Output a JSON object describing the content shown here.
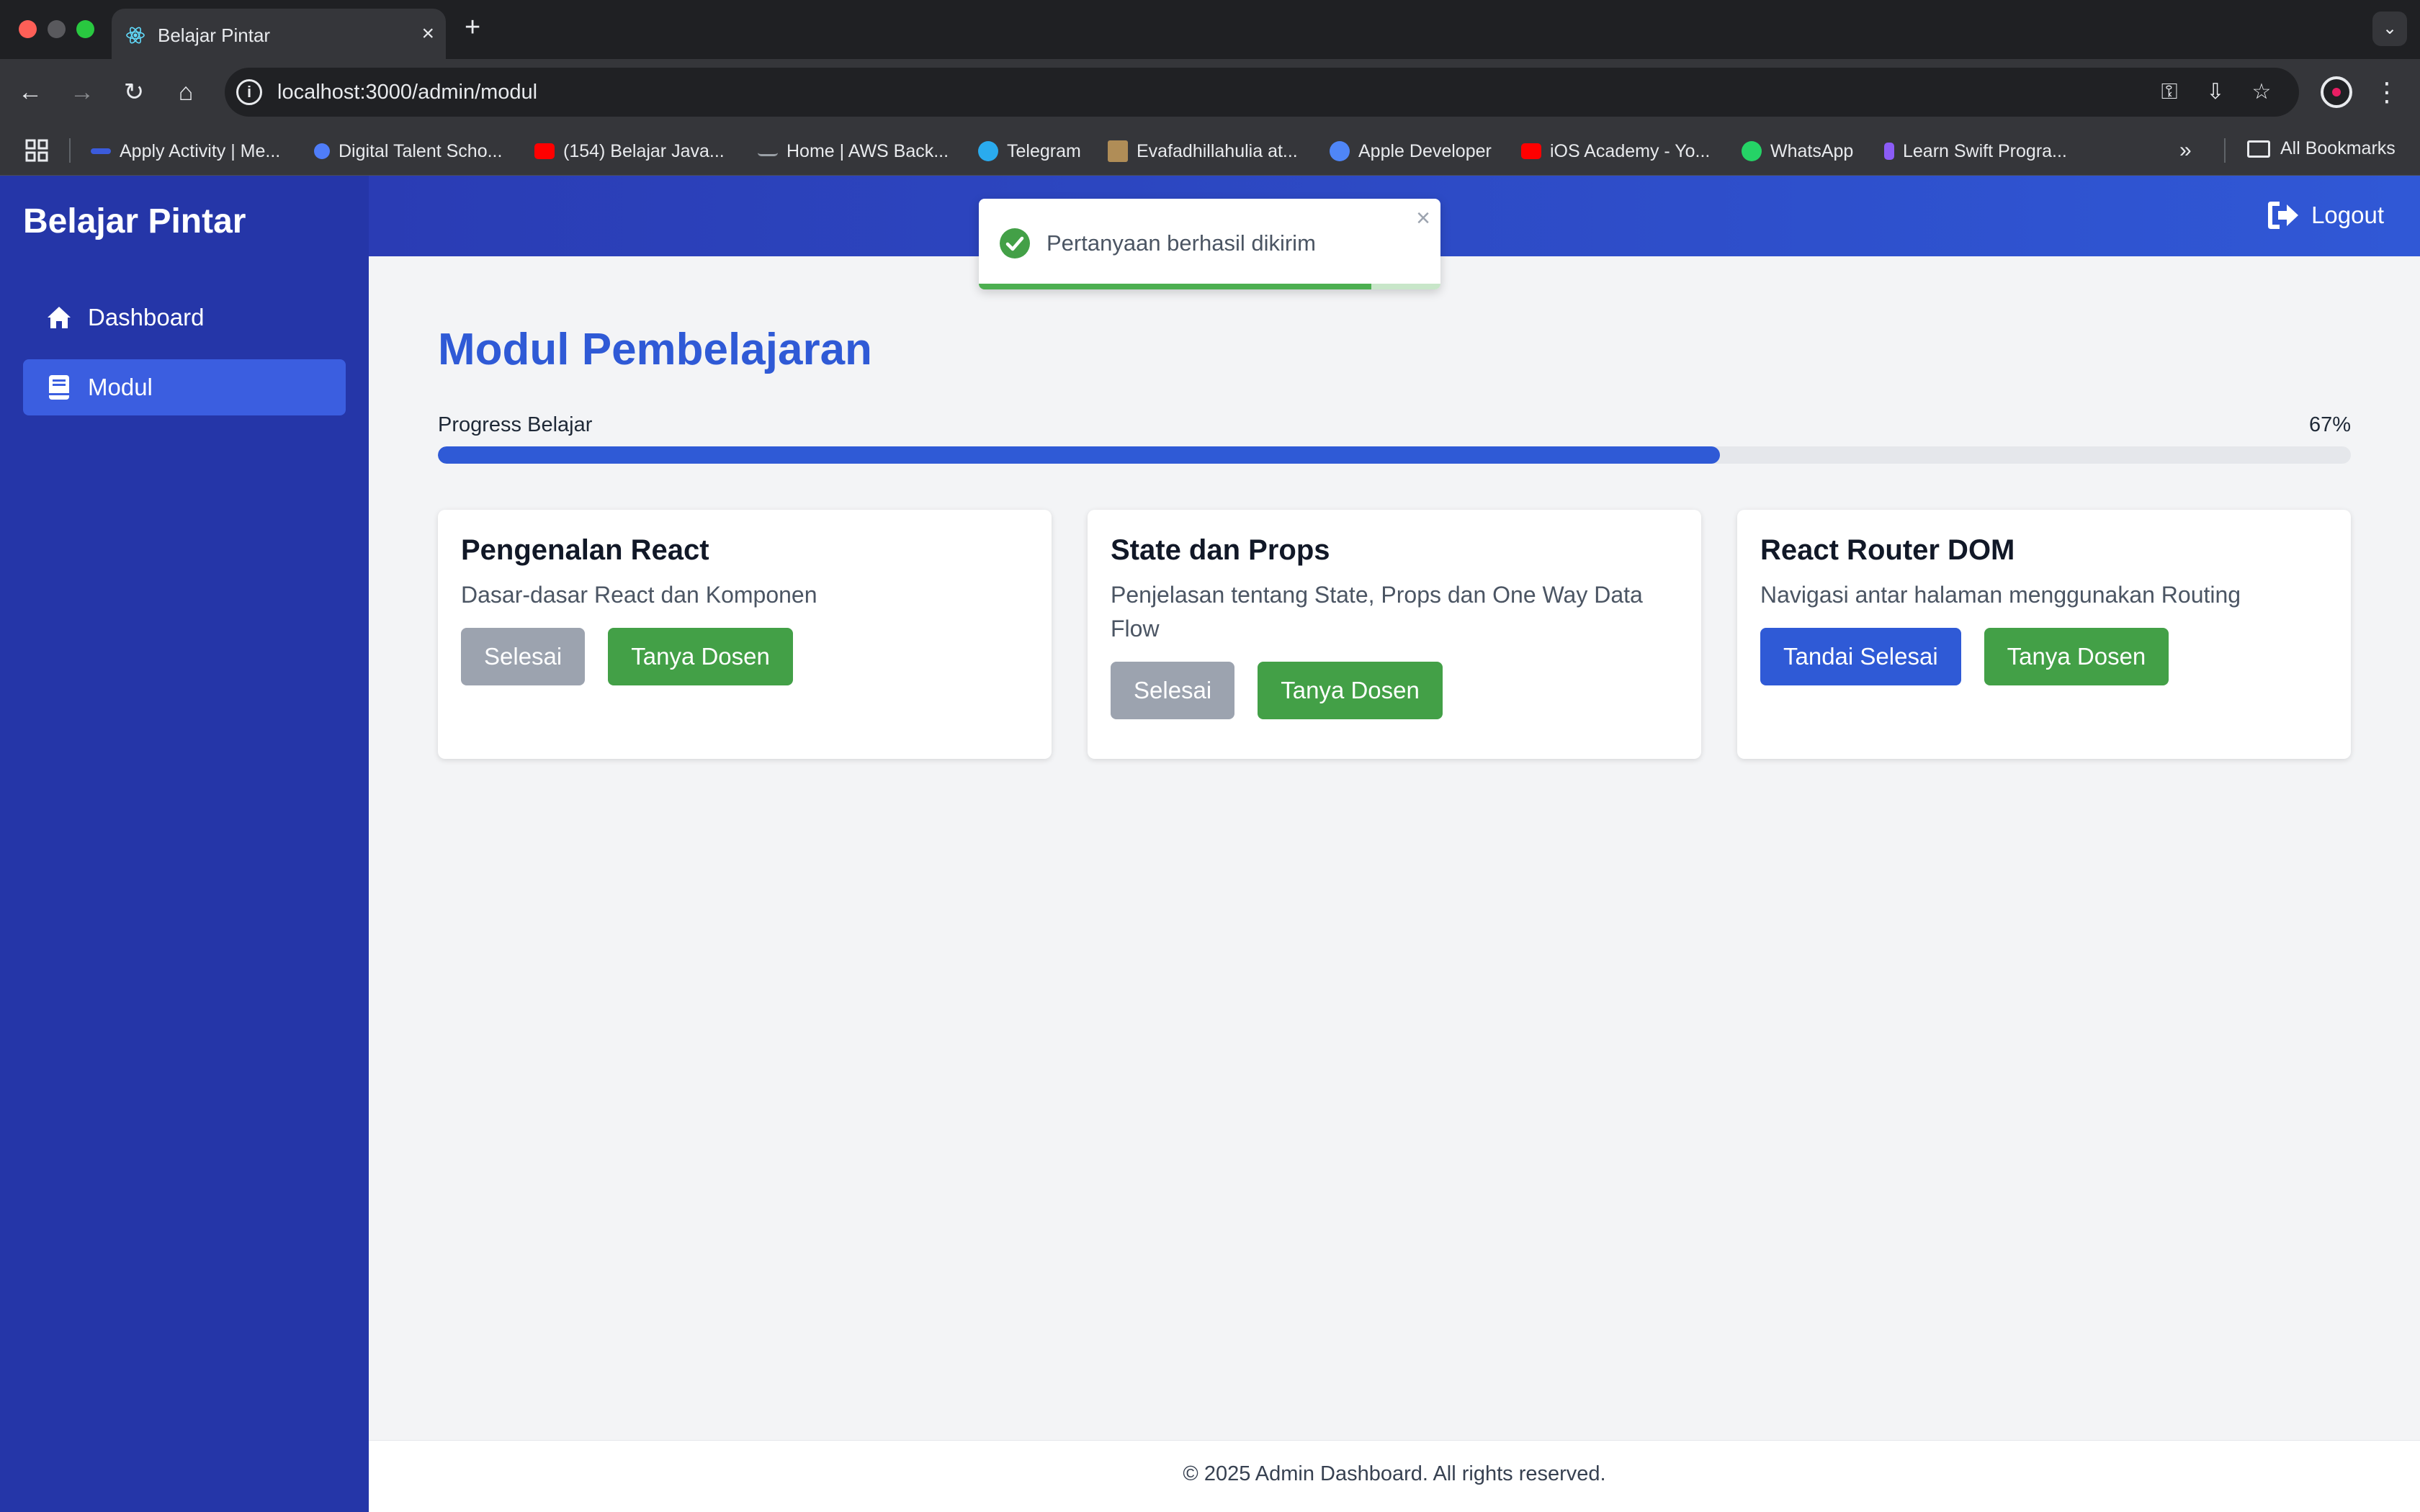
{
  "browser": {
    "tab_title": "Belajar Pintar",
    "tab_close": "×",
    "new_tab": "+",
    "url": "localhost:3000/admin/modul",
    "bookmarks": [
      {
        "label": "Apply Activity | Me...",
        "color": "#3b5bdb"
      },
      {
        "label": "Digital Talent Scho...",
        "color": "#4f7df9"
      },
      {
        "label": "(154) Belajar Java...",
        "color": "#ff0000"
      },
      {
        "label": "Home | AWS Back...",
        "color": "#9aa0a6"
      },
      {
        "label": "Telegram",
        "color": "#2aabee"
      },
      {
        "label": "Evafadhillahulia at...",
        "color": "#b08d57"
      },
      {
        "label": "Apple Developer",
        "color": "#4f86f7"
      },
      {
        "label": "iOS Academy - Yo...",
        "color": "#ff0000"
      },
      {
        "label": "WhatsApp",
        "color": "#25d366"
      },
      {
        "label": "Learn Swift Progra...",
        "color": "#8b5cf6"
      }
    ],
    "bookmarks_more": "»",
    "all_bookmarks": "All Bookmarks"
  },
  "sidebar": {
    "brand": "Belajar Pintar",
    "items": [
      {
        "label": "Dashboard",
        "icon": "home-icon",
        "active": false
      },
      {
        "label": "Modul",
        "icon": "book-icon",
        "active": true
      }
    ]
  },
  "topbar": {
    "logout_label": "Logout"
  },
  "main": {
    "title": "Modul Pembelajaran",
    "progress_label": "Progress Belajar",
    "progress_percent": "67%",
    "progress_value": 0.67,
    "cards": [
      {
        "title": "Pengenalan React",
        "desc": "Dasar-dasar React dan Komponen",
        "primary_label": "Selesai",
        "primary_state": "done",
        "ask_label": "Tanya Dosen"
      },
      {
        "title": "State dan Props",
        "desc": "Penjelasan tentang State, Props dan One Way Data Flow",
        "primary_label": "Selesai",
        "primary_state": "done",
        "ask_label": "Tanya Dosen"
      },
      {
        "title": "React Router DOM",
        "desc": "Navigasi antar halaman menggunakan Routing",
        "primary_label": "Tandai Selesai",
        "primary_state": "todo",
        "ask_label": "Tanya Dosen"
      }
    ]
  },
  "toast": {
    "message": "Pertanyaan berhasil dikirim",
    "close": "×",
    "remaining": 0.85
  },
  "footer": {
    "text": "© 2025 Admin Dashboard. All rights reserved."
  },
  "colors": {
    "sidebar": "#2536a8",
    "accent": "#2f5ad6",
    "success": "#43a047",
    "disabled": "#9ca3af"
  }
}
